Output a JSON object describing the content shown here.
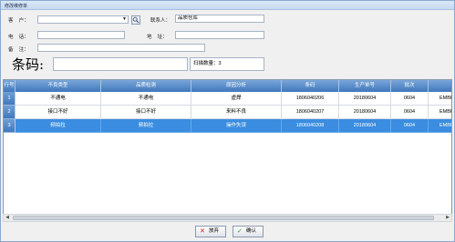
{
  "window": {
    "title": "修改维修单"
  },
  "form": {
    "customer_label": "客    户：",
    "customer_value": "",
    "contact_label": "联系人：",
    "contact_value": "品质仓库",
    "phone_label": "电    话：",
    "phone_value": "",
    "address_label": "地    址：",
    "address_value": "",
    "note_label": "备    注：",
    "note_value": ""
  },
  "barcode": {
    "label": "条码:",
    "value": "",
    "scan_count_text": "扫描数量：3"
  },
  "table": {
    "columns": [
      "行号",
      "不良类型",
      "品质检测",
      "原因分析",
      "条码",
      "生产单号",
      "批次",
      ""
    ],
    "rows": [
      {
        "num": "1",
        "cells": [
          "不通电",
          "不通电",
          "虚焊",
          "1806040206",
          "20180604",
          "0604",
          "EMBFN"
        ]
      },
      {
        "num": "2",
        "cells": [
          "接口不好",
          "接口不好",
          "来料不良",
          "1806040207",
          "20180604",
          "0604",
          "EMBFN"
        ]
      },
      {
        "num": "3",
        "cells": [
          "频拍拉",
          "频拍拉",
          "操作失误",
          "1806040208",
          "20180604",
          "0604",
          "EMBFN"
        ]
      }
    ],
    "selected_row": 3
  },
  "buttons": {
    "cancel_label": "放弃",
    "confirm_label": "确认"
  },
  "colors": {
    "header_blue": "#3f78bd",
    "selected_row": "#3a8de0",
    "cancel_red": "#d01818",
    "confirm_green": "#2e9a2e"
  }
}
